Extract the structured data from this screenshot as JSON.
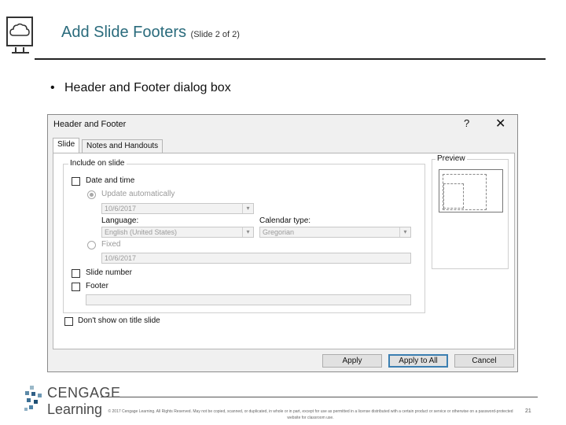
{
  "slide": {
    "title": "Add Slide Footers",
    "title_suffix": "(Slide 2 of 2)",
    "bullet": "Header and Footer dialog box",
    "copyright": "© 2017 Cengage Learning. All Rights Reserved. May not be copied, scanned, or duplicated, in whole or in part, except for use as permitted in a license distributed with a certain product or service or otherwise on a password-protected website for classroom use.",
    "page_number": "21",
    "logo": {
      "brand_top": "CENGAGE",
      "brand_bottom": "Learning",
      "icon": "cloud-icon"
    }
  },
  "dialog": {
    "title": "Header and Footer",
    "help": "?",
    "close": "✕",
    "tabs": [
      {
        "label": "Slide",
        "active": true
      },
      {
        "label": "Notes and Handouts",
        "active": false
      }
    ],
    "include_group": "Include on slide",
    "date_time": {
      "label": "Date and time",
      "checked": false
    },
    "update_automatically": {
      "label": "Update automatically",
      "selected": true
    },
    "date_value": "10/6/2017",
    "language_label": "Language:",
    "language_value": "English (United States)",
    "calendar_label": "Calendar type:",
    "calendar_value": "Gregorian",
    "fixed": {
      "label": "Fixed",
      "selected": false
    },
    "fixed_value": "10/6/2017",
    "slide_number": {
      "label": "Slide number",
      "checked": false
    },
    "footer": {
      "label": "Footer",
      "checked": false,
      "value": ""
    },
    "dont_show": {
      "label": "Don't show on title slide",
      "checked": false
    },
    "preview_label": "Preview",
    "buttons": {
      "apply": "Apply",
      "apply_all": "Apply to All",
      "cancel": "Cancel"
    }
  }
}
